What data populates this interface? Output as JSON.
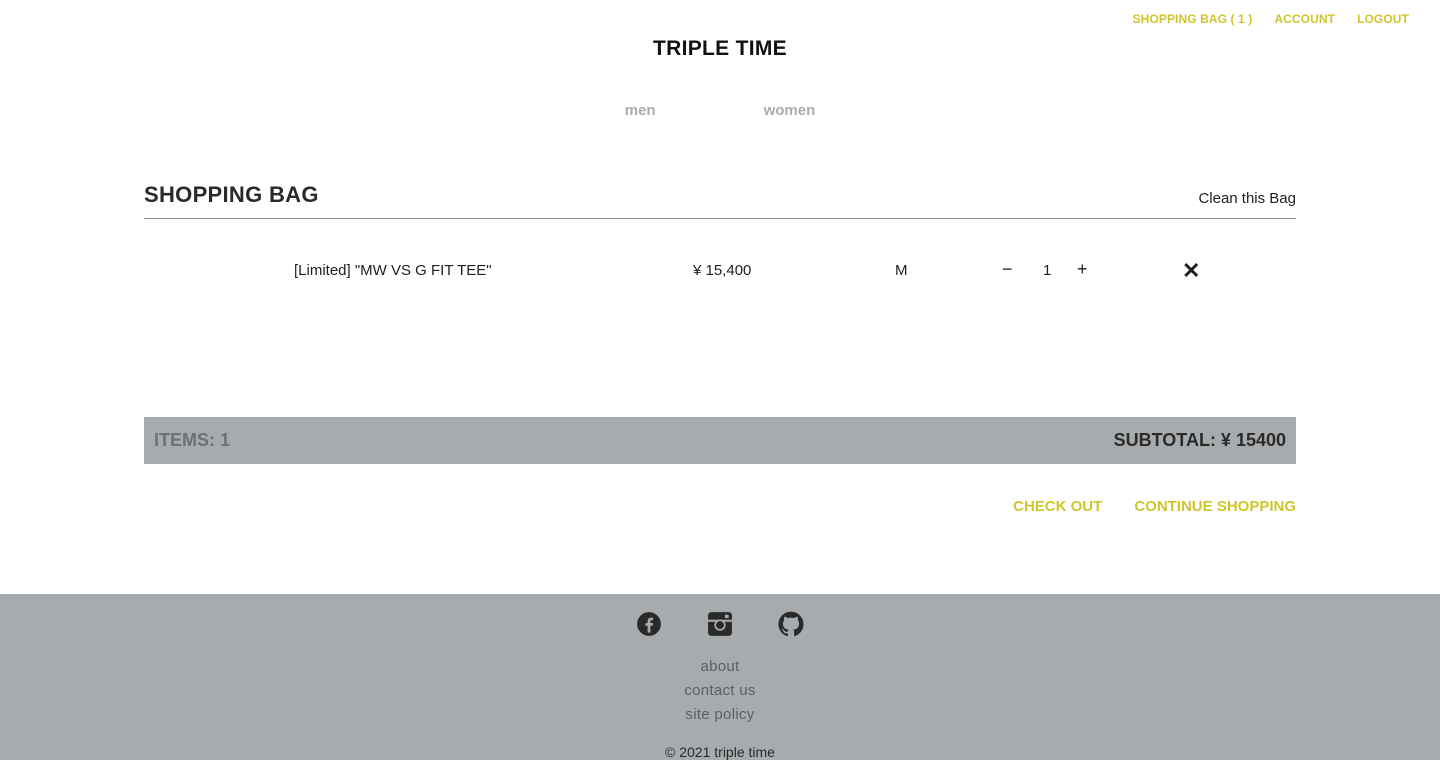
{
  "header": {
    "nav": {
      "shopping_bag": "SHOPPING BAG ( 1 )",
      "account": "ACCOUNT",
      "logout": "LOGOUT"
    },
    "brand": "TRIPLE TIME",
    "categories": [
      "men",
      "women"
    ]
  },
  "bag": {
    "title": "SHOPPING BAG",
    "clean_label": "Clean this Bag",
    "items": [
      {
        "name": "[Limited] \"MW VS G FIT TEE\"",
        "price": "¥ 15,400",
        "size": "M",
        "quantity": "1",
        "minus_symbol": "−",
        "plus_symbol": "+",
        "remove_symbol": "✕"
      }
    ],
    "summary": {
      "items": "ITEMS: 1",
      "subtotal": "SUBTOTAL:  ¥ 15400"
    },
    "actions": {
      "checkout": "CHECK OUT",
      "continue": "CONTINUE SHOPPING"
    }
  },
  "footer": {
    "social_icons": [
      "facebook-icon",
      "instagram-icon",
      "github-icon"
    ],
    "links": [
      "about",
      "contact us",
      "site policy"
    ],
    "copyright": "© 2021 triple time"
  },
  "colors": {
    "accent": "#cfc52b",
    "footer_bg": "#a8abad",
    "summary_bg": "#a8abad",
    "nav_muted": "#a9acae"
  }
}
